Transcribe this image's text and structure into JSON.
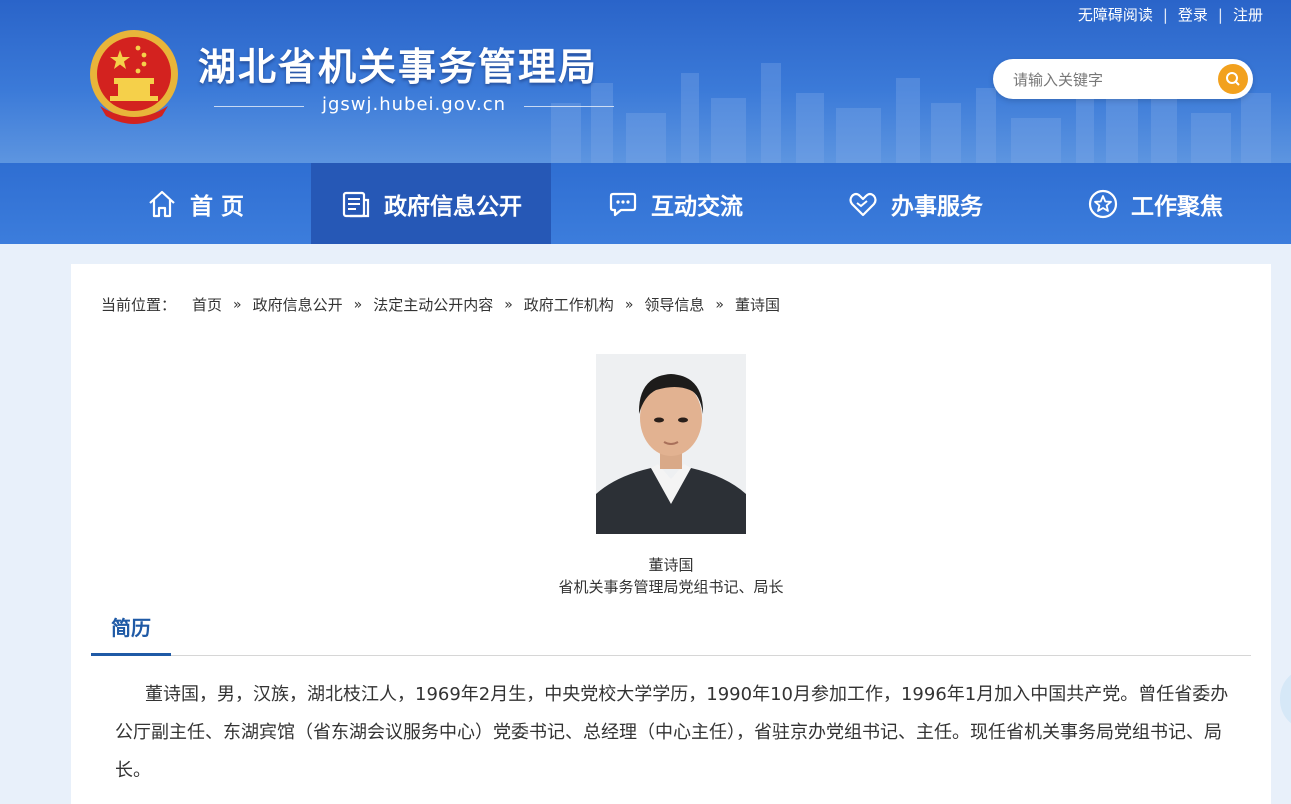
{
  "header": {
    "title": "湖北省机关事务管理局",
    "url": "jgswj.hubei.gov.cn",
    "top_links": {
      "accessible": "无障碍阅读",
      "login": "登录",
      "register": "注册",
      "separator": "|"
    },
    "search": {
      "placeholder": "请输入关键字"
    }
  },
  "nav": {
    "items": [
      {
        "label": "首 页",
        "icon": "home-icon"
      },
      {
        "label": "政府信息公开",
        "icon": "document-icon",
        "active": true
      },
      {
        "label": "互动交流",
        "icon": "chat-icon"
      },
      {
        "label": "办事服务",
        "icon": "heart-hand-icon"
      },
      {
        "label": "工作聚焦",
        "icon": "star-icon"
      }
    ]
  },
  "breadcrumb": {
    "label": "当前位置：",
    "separator": "»",
    "items": [
      "首页",
      "政府信息公开",
      "法定主动公开内容",
      "政府工作机构",
      "领导信息",
      "董诗国"
    ]
  },
  "leader": {
    "name": "董诗国",
    "position": "省机关事务管理局党组书记、局长"
  },
  "resume": {
    "tab_label": "简历",
    "text": "董诗国，男，汉族，湖北枝江人，1969年2月生，中央党校大学学历，1990年10月参加工作，1996年1月加入中国共产党。曾任省委办公厅副主任、东湖宾馆（省东湖会议服务中心）党委书记、总经理（中心主任），省驻京办党组书记、主任。现任省机关事务局党组书记、局长。"
  },
  "colors": {
    "header_blue": "#2a64c9",
    "nav_active": "#2658b6",
    "accent_orange": "#f2a11e",
    "tab_blue": "#1f5aa6"
  }
}
